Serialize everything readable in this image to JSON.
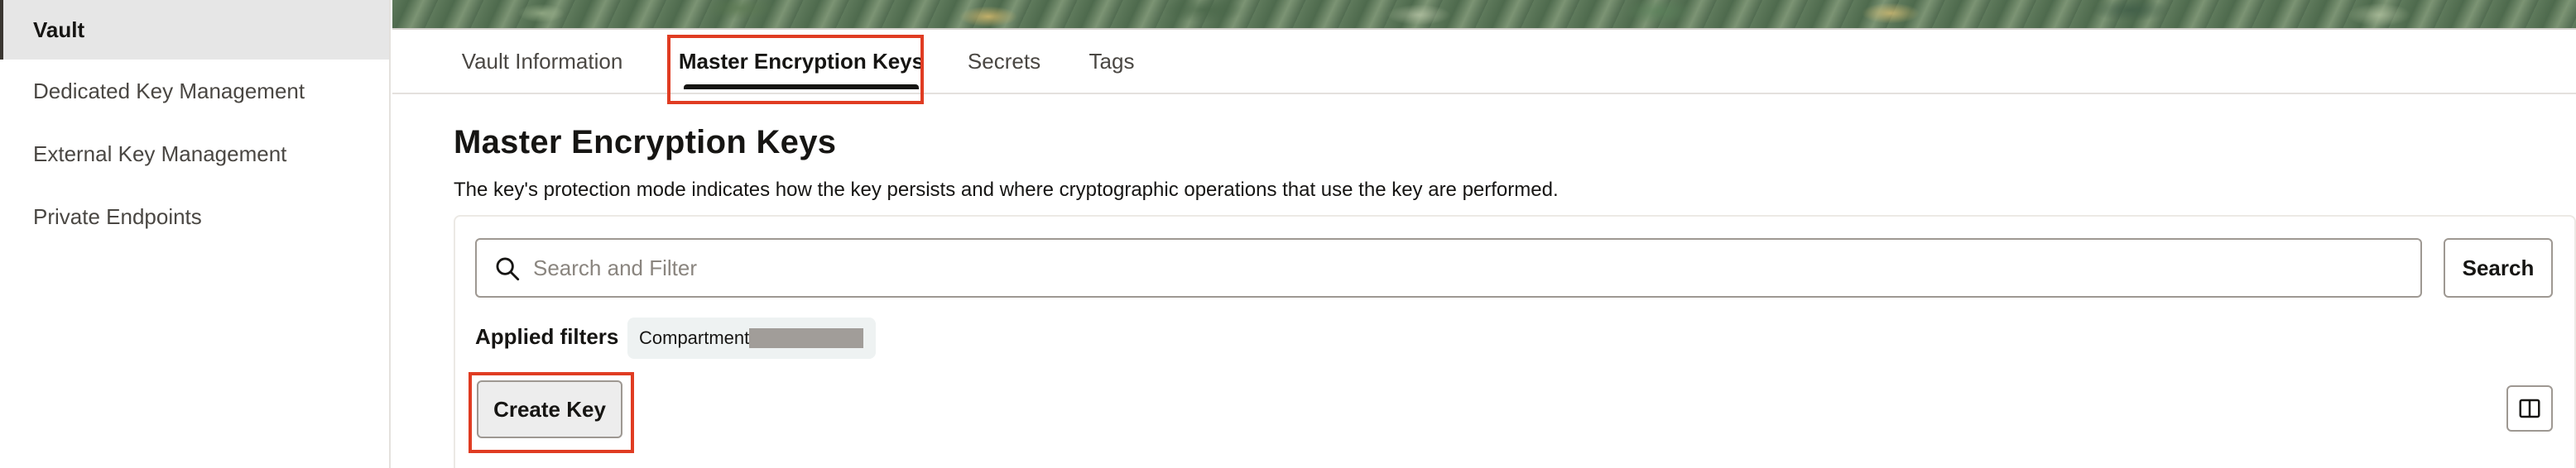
{
  "sidebar": {
    "items": [
      {
        "label": "Vault",
        "active": true
      },
      {
        "label": "Dedicated Key Management",
        "active": false
      },
      {
        "label": "External Key Management",
        "active": false
      },
      {
        "label": "Private Endpoints",
        "active": false
      }
    ]
  },
  "tabs": [
    {
      "label": "Vault Information",
      "selected": false
    },
    {
      "label": "Master Encryption Keys",
      "selected": true
    },
    {
      "label": "Secrets",
      "selected": false
    },
    {
      "label": "Tags",
      "selected": false
    }
  ],
  "main": {
    "title": "Master Encryption Keys",
    "description": "The key's protection mode indicates how the key persists and where cryptographic operations that use the key are performed."
  },
  "search": {
    "placeholder": "Search and Filter",
    "value": "",
    "button_label": "Search",
    "icon": "search-icon"
  },
  "filters": {
    "label": "Applied filters",
    "chips": [
      {
        "label": "Compartment",
        "value_redacted": true
      }
    ]
  },
  "actions": {
    "create_key_label": "Create Key",
    "columns_icon": "columns-icon"
  },
  "colors": {
    "highlight": "#e03c22",
    "active_text": "#161513",
    "sidebar_active_bg": "#e6e6e6"
  }
}
